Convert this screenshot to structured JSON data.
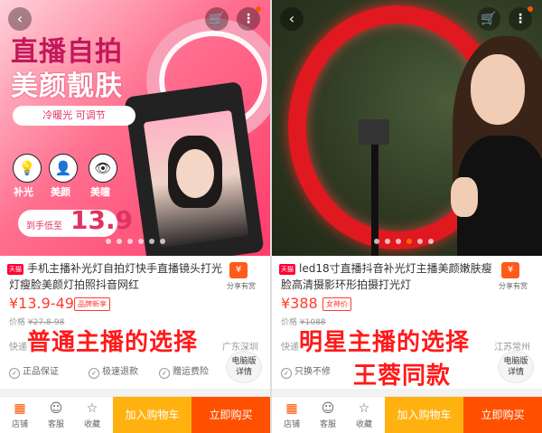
{
  "left": {
    "hero": {
      "headline1": "直播自拍",
      "headline2": "美颜靓肤",
      "tag": "冷暖光    可调节",
      "features": [
        "补光",
        "美颜",
        "美瞳"
      ],
      "price_pill_text": "到手低至",
      "price_pill_num": "13.9"
    },
    "mall_badge": "天猫",
    "title": "手机主播补光灯自拍灯快手直播镜头打光灯瘦脸美颜灯拍照抖音网红",
    "share_label": "分享有赏",
    "price": "¥13.9-49",
    "price_badge": "品牌新享",
    "orig_price_label": "价格",
    "orig_price": "¥27.8-98",
    "shipping": "快递",
    "location": "广东深圳",
    "overlay_caption": "普通主播的选择",
    "services": [
      "正品保证",
      "极速退款",
      "赠运费险"
    ],
    "pc_button": [
      "电脑版",
      "详情"
    ],
    "bottom": {
      "shop": "店铺",
      "service": "客服",
      "fav": "收藏",
      "add_cart": "加入购物车",
      "buy_now": "立即购买"
    }
  },
  "right": {
    "mall_badge": "天猫",
    "title": "led18寸直播抖音补光灯主播美颜嫩肤瘦脸高清摄影环形拍摄打光灯",
    "share_label": "分享有赏",
    "price": "¥388",
    "price_badge": "女神价",
    "orig_price_label": "价格",
    "orig_price": "¥1088",
    "shipping": "快递",
    "location": "江苏常州",
    "overlay_caption_1": "明星主播的选择",
    "overlay_caption_2": "王蓉同款",
    "services": [
      "只换不修"
    ],
    "pc_button": [
      "电脑版",
      "详情"
    ],
    "bottom": {
      "shop": "店铺",
      "service": "客服",
      "fav": "收藏",
      "add_cart": "加入购物车",
      "buy_now": "立即购买"
    }
  },
  "icons": {
    "back": "‹",
    "cart": "🛒",
    "more": "⋮",
    "check": "✓",
    "share": "¥"
  },
  "colors": {
    "accent": "#ff5000",
    "price": "#ff3b2f",
    "cart_button": "#ffb20f",
    "caption": "#ff1a1a",
    "tmall": "#ff0036"
  }
}
